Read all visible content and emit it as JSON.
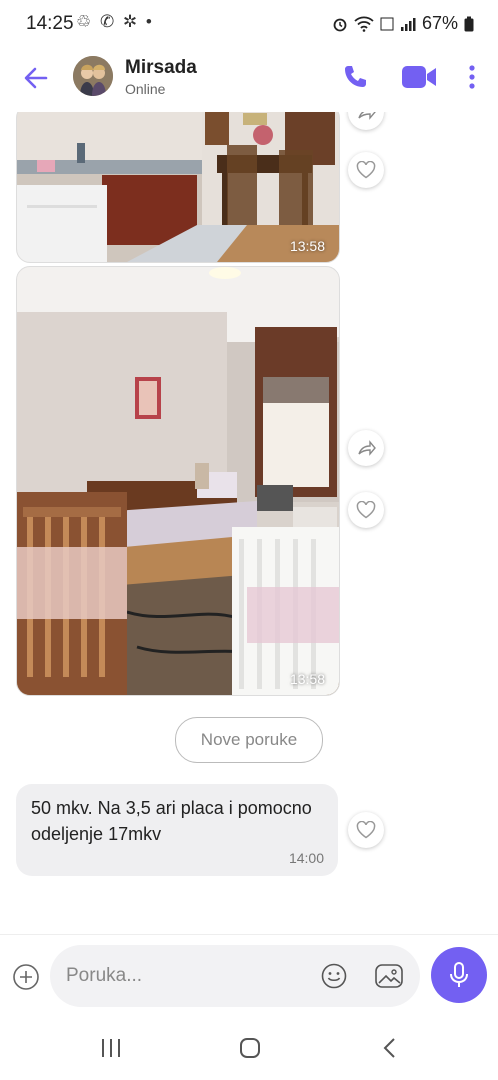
{
  "status_bar": {
    "time": "14:25",
    "left_icons": "♲ ✆ ✲ •",
    "battery": "67%"
  },
  "header": {
    "contact_name": "Mirsada",
    "contact_status": "Online"
  },
  "messages": {
    "photo1_time": "13:58",
    "photo2_time": "13:58",
    "new_messages_label": "Nove poruke",
    "text_message": "50 mkv. Na 3,5 ari placa i pomocno odeljenje 17mkv",
    "text_time": "14:00"
  },
  "composer": {
    "placeholder": "Poruka..."
  },
  "colors": {
    "accent": "#7360f2"
  }
}
